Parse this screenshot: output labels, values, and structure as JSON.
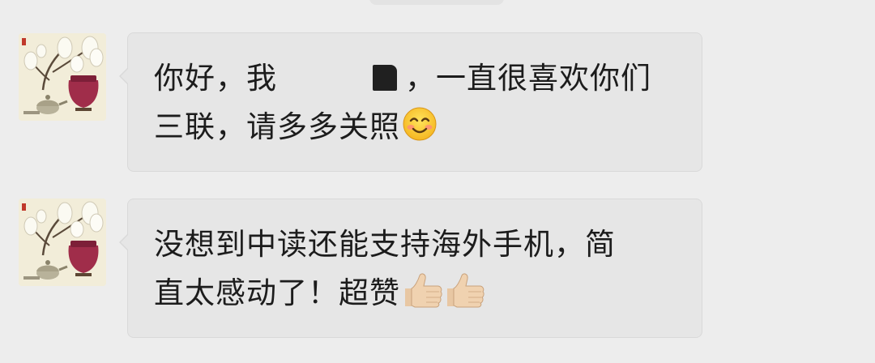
{
  "messages": [
    {
      "sender_avatar": "magnolia-painting-avatar",
      "line1_before_redaction": "你好，我",
      "line1_after_redaction": "，一直很喜欢你们",
      "line2": "三联，请多多关照",
      "trailing_emoji": "smiling-face-emoji"
    },
    {
      "sender_avatar": "magnolia-painting-avatar",
      "line1": "没想到中读还能支持海外手机，简",
      "line2": "直太感动了！超赞",
      "trailing_emoji": "thumbs-up-emoji"
    }
  ],
  "colors": {
    "background": "#ededed",
    "bubble": "#e6e6e6",
    "bubble_border": "#d9d9d9",
    "text": "#1c1c1c",
    "redaction": "#202020"
  }
}
